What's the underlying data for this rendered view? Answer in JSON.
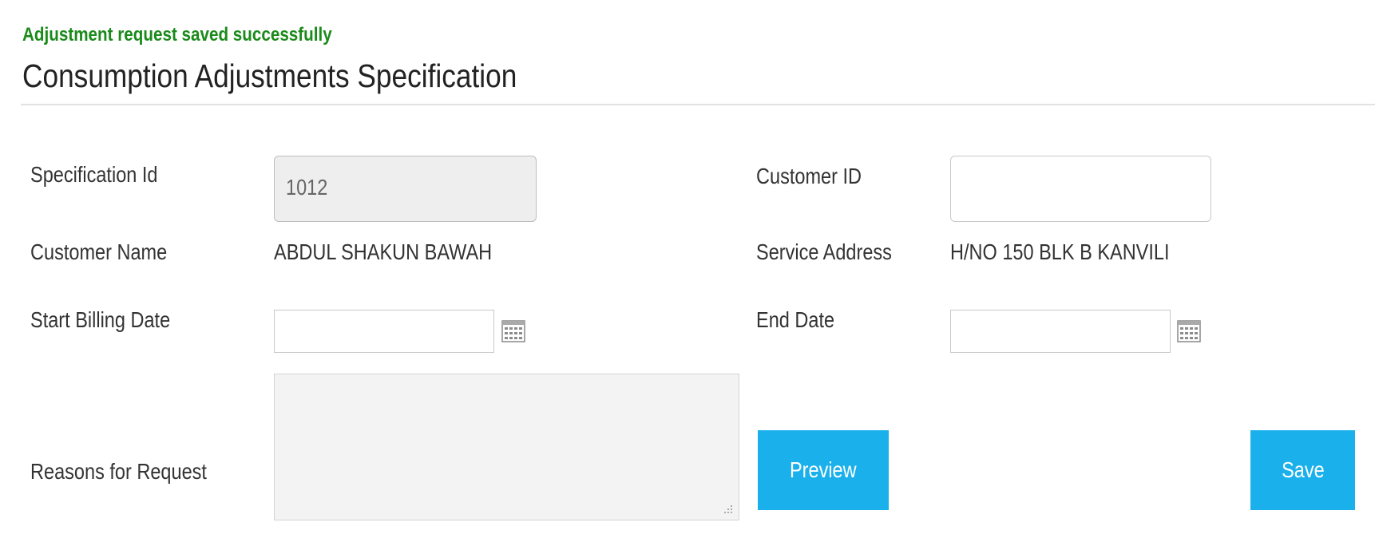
{
  "status_message": "Adjustment request saved successfully",
  "page_title": "Consumption Adjustments Specification",
  "form": {
    "specification_id": {
      "label": "Specification Id",
      "value": "1012"
    },
    "customer_id": {
      "label": "Customer ID",
      "value": ""
    },
    "customer_name": {
      "label": "Customer Name",
      "value": "ABDUL SHAKUN BAWAH"
    },
    "service_address": {
      "label": "Service Address",
      "value": "H/NO 150 BLK B KANVILI"
    },
    "start_billing_date": {
      "label": "Start Billing Date",
      "value": "",
      "icon": "calendar-icon"
    },
    "end_date": {
      "label": "End Date",
      "value": "",
      "icon": "calendar-icon"
    },
    "reasons": {
      "label": "Reasons for Request",
      "value": ""
    }
  },
  "buttons": {
    "preview": "Preview",
    "save": "Save"
  },
  "colors": {
    "success": "#1a8a1a",
    "button": "#19b0ec",
    "readonly_bg": "#eeeeee"
  }
}
